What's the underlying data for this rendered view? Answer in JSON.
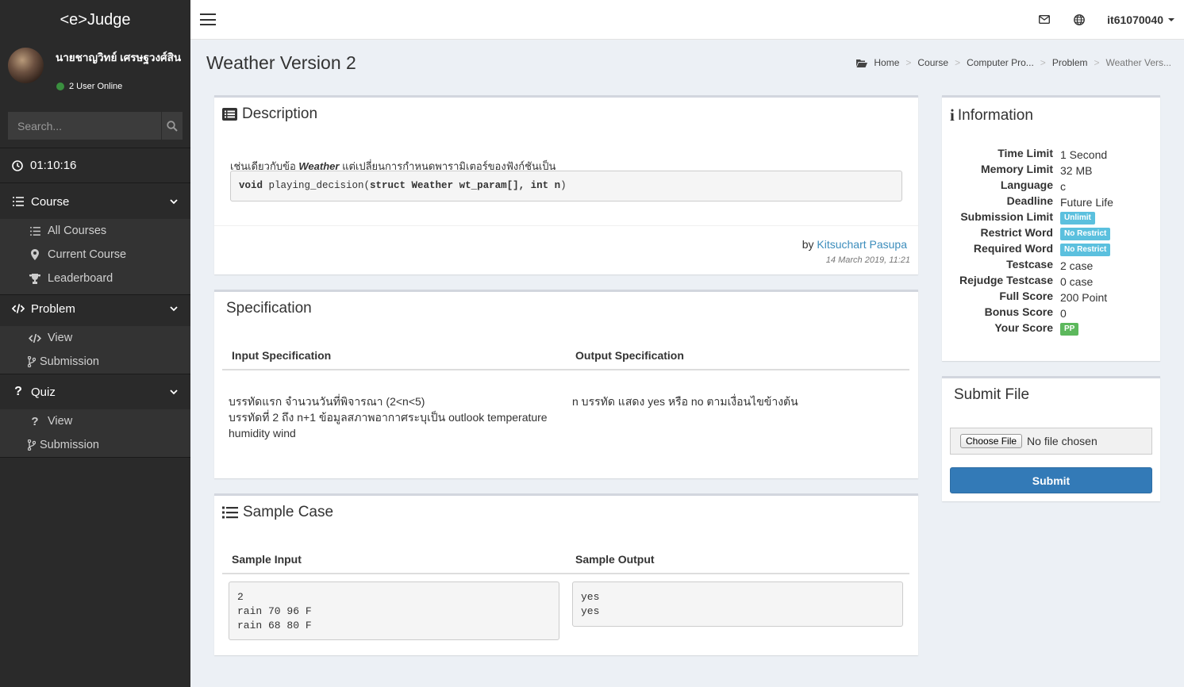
{
  "app": {
    "logo": "<e>Judge"
  },
  "user": {
    "name": "นายชาญวิทย์ เศรษฐวงศ์สิน",
    "online": "2 User Online",
    "id": "it61070040"
  },
  "search": {
    "placeholder": "Search..."
  },
  "timer": "01:10:16",
  "sidebar": {
    "course": {
      "label": "Course",
      "items": [
        "All Courses",
        "Current Course",
        "Leaderboard"
      ]
    },
    "problem": {
      "label": "Problem",
      "items": [
        "View",
        "Submission"
      ]
    },
    "quiz": {
      "label": "Quiz",
      "items": [
        "View",
        "Submission"
      ]
    }
  },
  "page": {
    "title": "Weather Version 2"
  },
  "breadcrumb": [
    "Home",
    "Course",
    "Computer Pro...",
    "Problem",
    "Weather Vers..."
  ],
  "description": {
    "title": "Description",
    "text_before": "เช่นเดียวกับข้อ ",
    "text_bold": "Weather",
    "text_after": " แต่เปลี่ยนการกำหนดพารามิเตอร์ของฟังก์ชันเป็น",
    "code_kw1": "void",
    "code_fn": " playing_decision(",
    "code_kw2": "struct Weather wt_param[], int n",
    "code_end": ")",
    "author_prefix": "by ",
    "author": "Kitsuchart Pasupa",
    "date": "14 March 2019, 11:21"
  },
  "specification": {
    "title": "Specification",
    "input_header": "Input Specification",
    "output_header": "Output Specification",
    "input_line1": "บรรทัดแรก จำนวนวันที่พิจารณา (2<n<5)",
    "input_line2": "บรรทัดที่ 2 ถึง n+1 ข้อมูลสภาพอากาศระบุเป็น outlook temperature humidity wind",
    "output_text": "n บรรทัด แสดง yes หรือ no ตามเงื่อนไขข้างต้น"
  },
  "sample": {
    "title": "Sample Case",
    "input_header": "Sample Input",
    "output_header": "Sample Output",
    "input": "2\nrain 70 96 F\nrain 68 80 F",
    "output": "yes\nyes"
  },
  "information": {
    "title": "Information",
    "rows": [
      {
        "label": "Time Limit",
        "value": "1 Second"
      },
      {
        "label": "Memory Limit",
        "value": "32 MB"
      },
      {
        "label": "Language",
        "value": "c"
      },
      {
        "label": "Deadline",
        "value": "Future Life"
      },
      {
        "label": "Submission Limit",
        "badge": "Unlimit"
      },
      {
        "label": "Restrict Word",
        "badge": "No Restrict"
      },
      {
        "label": "Required Word",
        "badge": "No Restrict"
      },
      {
        "label": "Testcase",
        "value": "2 case"
      },
      {
        "label": "Rejudge Testcase",
        "value": "0 case"
      },
      {
        "label": "Full Score",
        "value": "200 Point"
      },
      {
        "label": "Bonus Score",
        "value": "0"
      },
      {
        "label": "Your Score",
        "badge": "PP"
      }
    ],
    "badge_color": "#5bc0de",
    "score_badge_color": "#5cb85c"
  },
  "submit": {
    "title": "Submit File",
    "choose_label": "Choose File",
    "no_file": "No file chosen",
    "submit_label": "Submit"
  },
  "colors": {
    "sidebar_bg": "#2a2a2a",
    "link": "#3c8dbc",
    "primary": "#337ab7"
  }
}
